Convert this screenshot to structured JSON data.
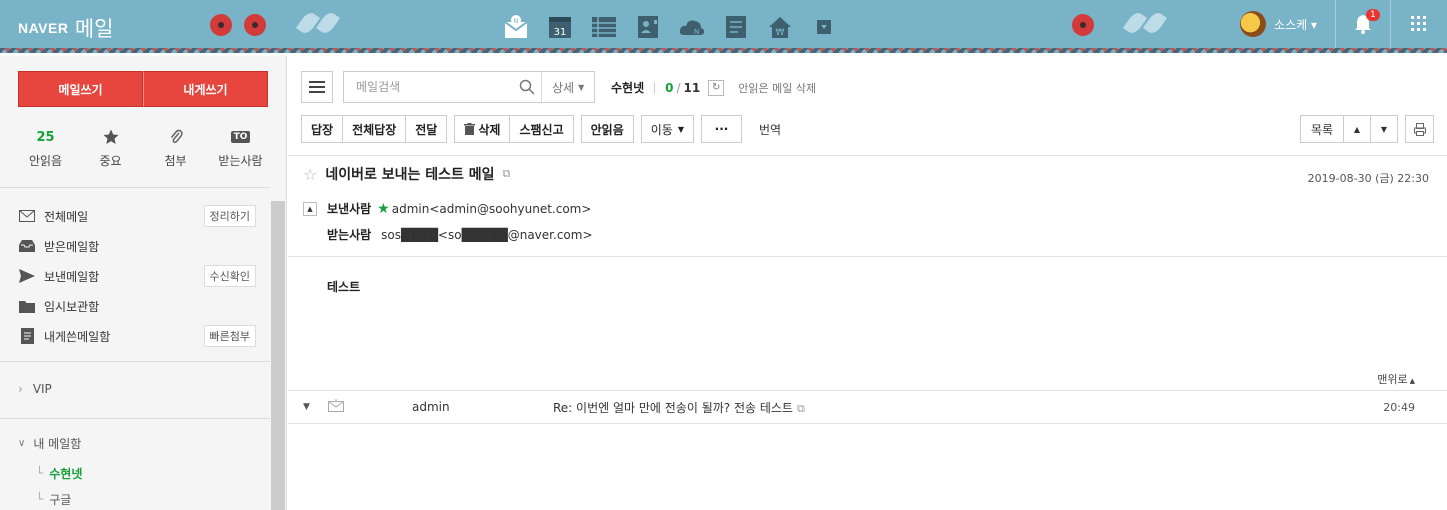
{
  "header": {
    "brand": "NAVER",
    "service": "메일",
    "user_name": "소스케",
    "notification_count": "1",
    "apps": [
      "mail-app-icon",
      "calendar-icon",
      "contacts-list-icon",
      "address-book-icon",
      "cloud-icon",
      "memo-icon",
      "money-home-icon",
      "more-apps-icon"
    ],
    "calendar_day": "31",
    "colors": {
      "bg": "#78b3c7",
      "flower": "#d33a3a"
    }
  },
  "sidebar": {
    "compose_label": "메일쓰기",
    "self_compose_label": "내게쓰기",
    "quick": [
      {
        "icon": "unread-count",
        "value": "25",
        "label": "안읽음"
      },
      {
        "icon": "star-icon",
        "label": "중요"
      },
      {
        "icon": "paperclip-icon",
        "label": "첨부"
      },
      {
        "icon": "to-icon",
        "badge": "TO",
        "label": "받는사람"
      }
    ],
    "folders": [
      {
        "icon": "envelope-icon",
        "label": "전체메일",
        "action": "정리하기"
      },
      {
        "icon": "inbox-icon",
        "label": "받은메일함"
      },
      {
        "icon": "send-icon",
        "label": "보낸메일함",
        "action": "수신확인"
      },
      {
        "icon": "folder-icon",
        "label": "임시보관함"
      },
      {
        "icon": "note-icon",
        "label": "내게쓴메일함",
        "action": "빠른첨부"
      }
    ],
    "vip_label": "VIP",
    "my_mailbox_label": "내 메일함",
    "my_mailboxes": [
      {
        "label": "수현넷",
        "active": true
      },
      {
        "label": "구글",
        "active": false
      }
    ]
  },
  "toolbar": {
    "search_placeholder": "메일검색",
    "detail_label": "상세",
    "account_name": "수현넷",
    "unread": "0",
    "total": "11",
    "delete_unread_label": "안읽은 메일 삭제",
    "reply": "답장",
    "reply_all": "전체답장",
    "forward": "전달",
    "delete": "삭제",
    "spam": "스팸신고",
    "mark_unread": "안읽음",
    "move": "이동",
    "more": "···",
    "translate": "번역",
    "list": "목록"
  },
  "message": {
    "subject": "네이버로 보내는 테스트 메일",
    "date": "2019-08-30 (금) 22:30",
    "sender_label": "보낸사람",
    "sender": "admin<admin@soohyunet.com>",
    "recipient_label": "받는사람",
    "recipient": "sos████<so█████@naver.com>",
    "body": "테스트",
    "to_top": "맨위로"
  },
  "thread": {
    "from": "admin",
    "subject": "Re: 이번엔 얼마 만에 전송이 될까? 전송 테스트",
    "time": "20:49"
  }
}
